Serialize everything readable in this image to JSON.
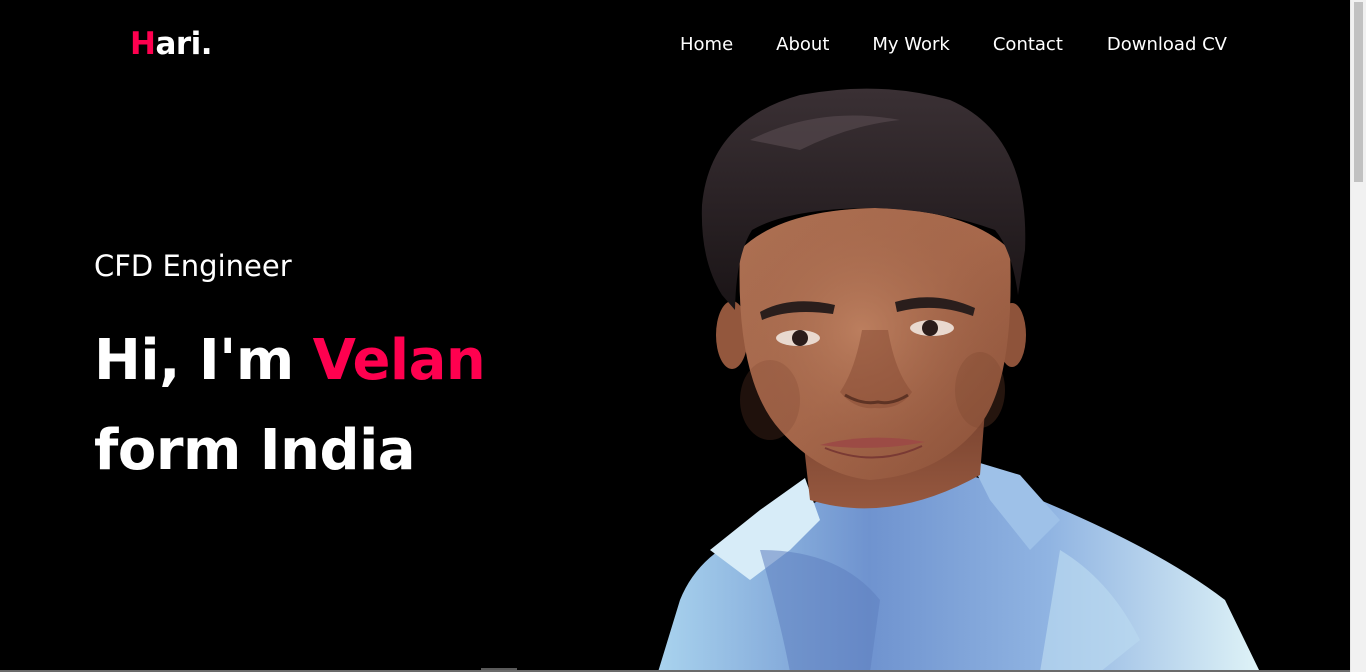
{
  "header": {
    "logo_initial": "H",
    "logo_rest": "ari.",
    "nav": {
      "home": "Home",
      "about": "About",
      "my_work": "My Work",
      "contact": "Contact",
      "download_cv": "Download CV"
    }
  },
  "hero": {
    "subtitle": "CFD Engineer",
    "greeting": "Hi, I'm ",
    "name": "Velan",
    "line2": "form India"
  },
  "colors": {
    "accent": "#ff004f",
    "background": "#000000",
    "text": "#ffffff"
  }
}
